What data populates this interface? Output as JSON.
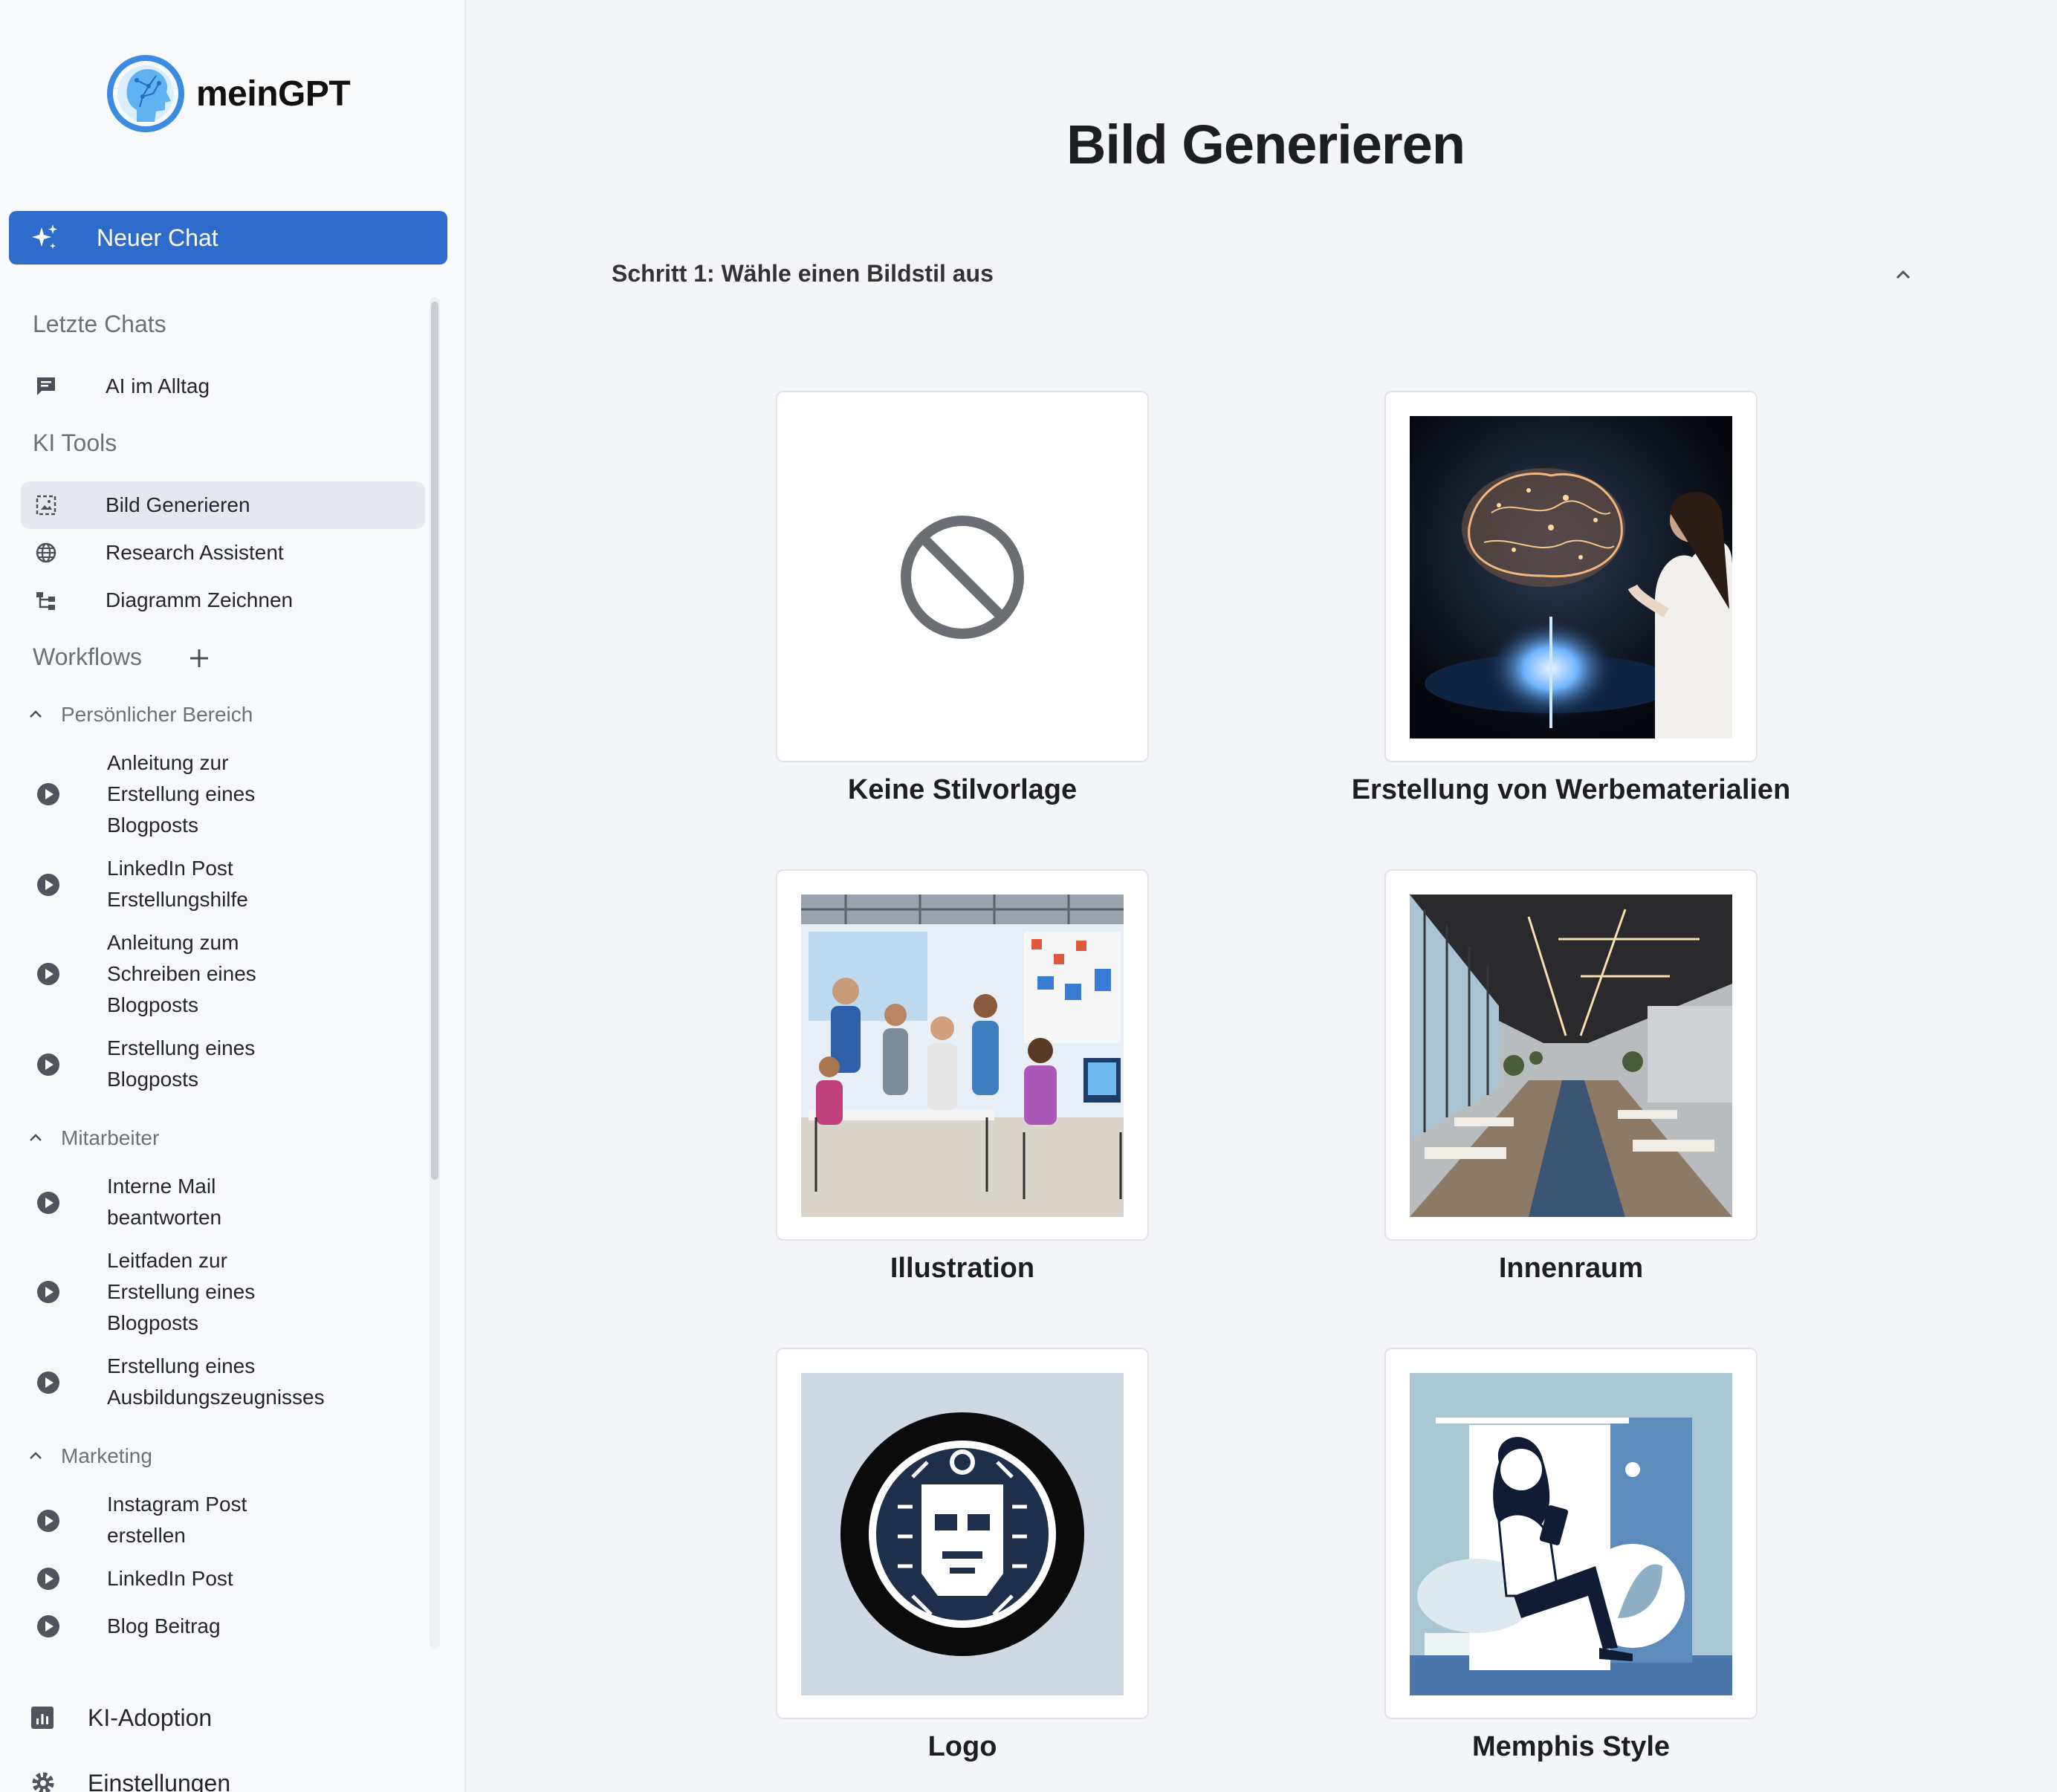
{
  "app": {
    "logo_text": "meinGPT"
  },
  "sidebar": {
    "new_chat_label": "Neuer Chat",
    "recent_heading": "Letzte Chats",
    "recent_chats": [
      {
        "label": "AI im Alltag",
        "icon": "chat-icon"
      }
    ],
    "tools_heading": "KI Tools",
    "tools": [
      {
        "label": "Bild Generieren",
        "icon": "image-icon",
        "active": true
      },
      {
        "label": "Research Assistent",
        "icon": "globe-icon"
      },
      {
        "label": "Diagramm Zeichnen",
        "icon": "diagram-icon"
      }
    ],
    "workflows_heading": "Workflows",
    "groups": [
      {
        "label": "Persönlicher Bereich",
        "expanded": true,
        "items": [
          {
            "label": "Anleitung zur Erstellung eines Blogposts"
          },
          {
            "label": "LinkedIn Post Erstellungshilfe"
          },
          {
            "label": "Anleitung zum Schreiben eines Blogposts"
          },
          {
            "label": "Erstellung eines Blogposts"
          }
        ]
      },
      {
        "label": "Mitarbeiter",
        "expanded": true,
        "items": [
          {
            "label": "Interne Mail beantworten"
          },
          {
            "label": "Leitfaden zur Erstellung eines Blogposts"
          },
          {
            "label": "Erstellung eines Ausbildungszeugnisses"
          }
        ]
      },
      {
        "label": "Marketing",
        "expanded": true,
        "items": [
          {
            "label": "Instagram Post erstellen"
          },
          {
            "label": "LinkedIn Post"
          },
          {
            "label": "Blog Beitrag"
          }
        ]
      }
    ],
    "bottom": [
      {
        "label": "KI-Adoption",
        "icon": "chart-icon"
      },
      {
        "label": "Einstellungen",
        "icon": "gear-icon"
      }
    ]
  },
  "main": {
    "title": "Bild Generieren",
    "step_label": "Schritt 1: Wähle einen Bildstil aus",
    "styles": [
      {
        "label": "Keine Stilvorlage",
        "thumb": "no-style-icon"
      },
      {
        "label": "Erstellung von Werbematerialien",
        "thumb": "brain-hologram-image"
      },
      {
        "label": "Illustration",
        "thumb": "office-team-illustration"
      },
      {
        "label": "Innenraum",
        "thumb": "office-interior-image"
      },
      {
        "label": "Logo",
        "thumb": "robot-logo-image"
      },
      {
        "label": "Memphis Style",
        "thumb": "memphis-woman-tablet-image"
      }
    ]
  },
  "colors": {
    "accent": "#2f6bcb",
    "sidebar_bg": "#f8f9fb",
    "main_bg": "#f3f5f9",
    "active_item": "#e5e8ee"
  }
}
